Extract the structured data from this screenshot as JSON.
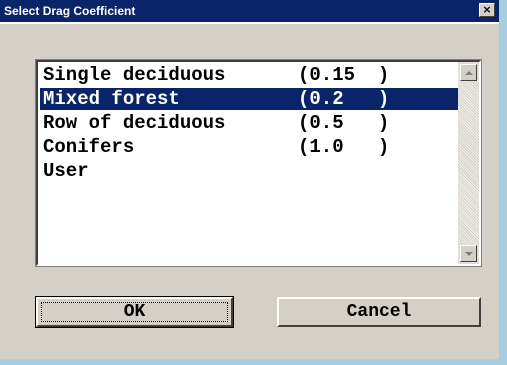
{
  "window": {
    "title": "Select Drag Coefficient",
    "close_glyph": "×"
  },
  "list": {
    "items": [
      {
        "name": "Single deciduous",
        "value": "(0.15  )",
        "selected": false
      },
      {
        "name": "Mixed forest",
        "value": "(0.2   )",
        "selected": true
      },
      {
        "name": "Row of deciduous",
        "value": "(0.5   )",
        "selected": false
      },
      {
        "name": "Conifers",
        "value": "(1.0   )",
        "selected": false
      },
      {
        "name": "User",
        "value": "",
        "selected": false
      }
    ]
  },
  "buttons": {
    "ok_label": "OK",
    "cancel_label": "Cancel"
  },
  "colors": {
    "title_bar": "#0a246a",
    "selection": "#0a246a",
    "dialog_face": "#d4d0c8"
  },
  "icons": {
    "close": "close-icon",
    "scroll_up": "scroll-up-arrow-icon",
    "scroll_down": "scroll-down-arrow-icon"
  }
}
